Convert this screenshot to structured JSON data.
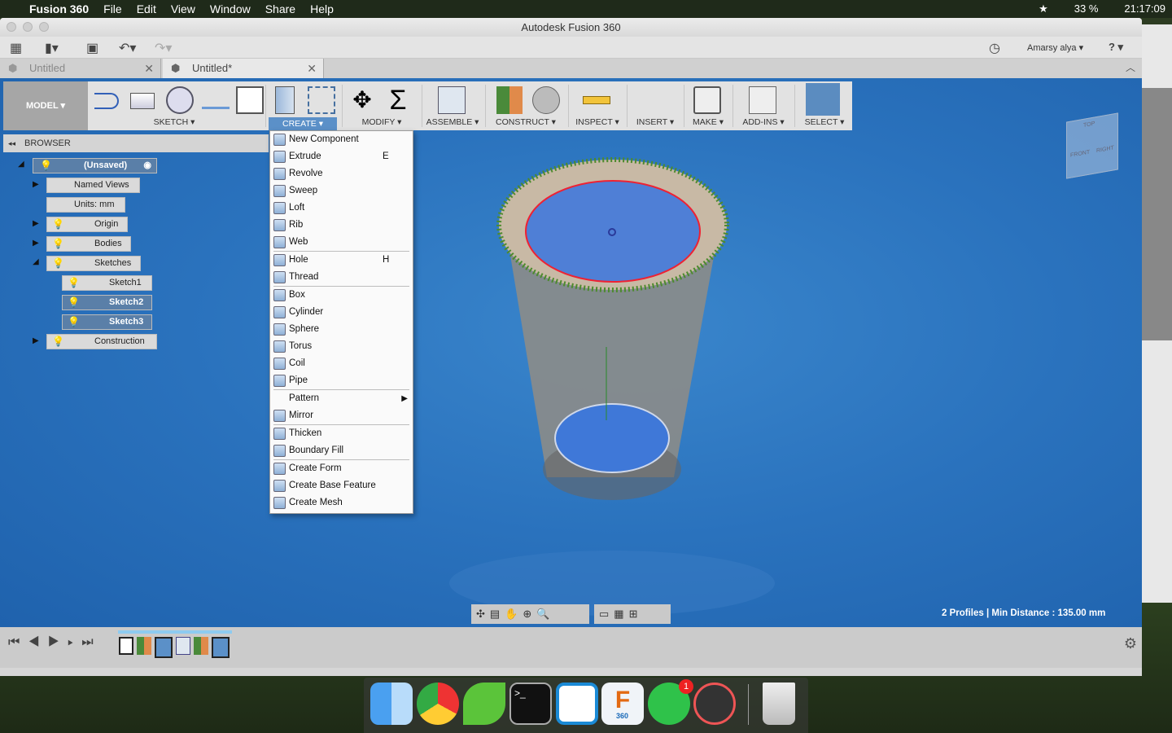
{
  "menubar": {
    "app": "Fusion 360",
    "items": [
      "File",
      "Edit",
      "View",
      "Window",
      "Share",
      "Help"
    ],
    "battery": "33 %",
    "clock": "21:17:09"
  },
  "window": {
    "title": "Autodesk Fusion 360",
    "user": "Amarsy alya ▾",
    "help": "? ▾"
  },
  "tabs": [
    {
      "label": "Untitled"
    },
    {
      "label": "Untitled*"
    }
  ],
  "toolbar": {
    "workspace": "MODEL ▾",
    "groups": [
      "SKETCH ▾",
      "CREATE ▾",
      "MODIFY ▾",
      "ASSEMBLE ▾",
      "CONSTRUCT ▾",
      "INSPECT ▾",
      "INSERT ▾",
      "MAKE ▾",
      "ADD-INS ▾",
      "SELECT ▾"
    ]
  },
  "browser": {
    "title": "BROWSER",
    "items": [
      {
        "label": "(Unsaved)",
        "selected": true
      },
      {
        "label": "Named Views"
      },
      {
        "label": "Units: mm"
      },
      {
        "label": "Origin"
      },
      {
        "label": "Bodies"
      },
      {
        "label": "Sketches"
      },
      {
        "label": "Sketch1"
      },
      {
        "label": "Sketch2",
        "selected": true
      },
      {
        "label": "Sketch3",
        "selected": true
      },
      {
        "label": "Construction"
      }
    ]
  },
  "create_menu": [
    {
      "label": "New Component"
    },
    {
      "label": "Extrude",
      "key": "E"
    },
    {
      "label": "Revolve"
    },
    {
      "label": "Sweep"
    },
    {
      "label": "Loft"
    },
    {
      "label": "Rib"
    },
    {
      "label": "Web"
    },
    {
      "sep": true
    },
    {
      "label": "Hole",
      "key": "H"
    },
    {
      "label": "Thread"
    },
    {
      "sep": true
    },
    {
      "label": "Box"
    },
    {
      "label": "Cylinder"
    },
    {
      "label": "Sphere"
    },
    {
      "label": "Torus"
    },
    {
      "label": "Coil"
    },
    {
      "label": "Pipe"
    },
    {
      "sep": true
    },
    {
      "label": "Pattern",
      "submenu": true
    },
    {
      "label": "Mirror"
    },
    {
      "sep": true
    },
    {
      "label": "Thicken"
    },
    {
      "label": "Boundary Fill"
    },
    {
      "sep": true
    },
    {
      "label": "Create Form"
    },
    {
      "label": "Create Base Feature"
    },
    {
      "label": "Create Mesh"
    }
  ],
  "viewcube": {
    "top": "TOP",
    "front": "FRONT",
    "right": "RIGHT"
  },
  "status": "2 Profiles | Min Distance : 135.00 mm",
  "dock": {
    "whatsapp_badge": "1",
    "fusion_label": "360"
  },
  "colors": {
    "viewport": "#2a72bd",
    "accent": "#5b90c8"
  }
}
